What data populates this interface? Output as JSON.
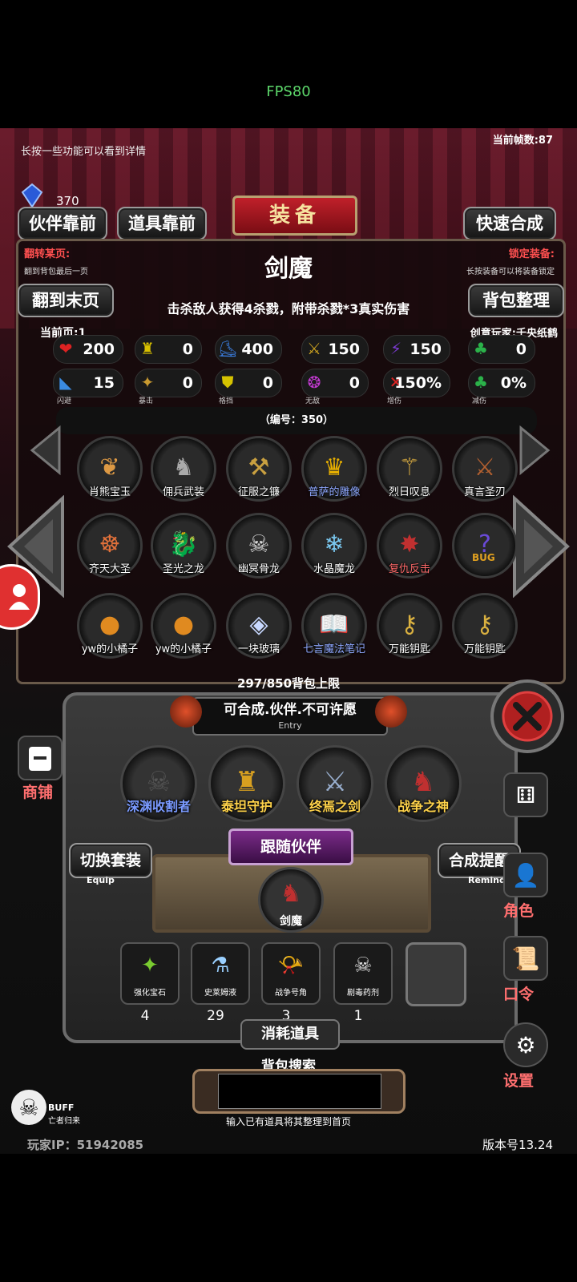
{
  "fps": "FPS80",
  "top_hint": "长按一些功能可以看到详情",
  "framerate": "当前帧数:87",
  "gems": {
    "count": "370"
  },
  "buttons": {
    "partner_first": "伙伴靠前",
    "item_first": "道具靠前",
    "quick_combine": "快速合成",
    "to_last_page": "翻到末页",
    "bag_sort": "背包整理"
  },
  "title": "装备",
  "page_jump": {
    "label": "翻转某页:",
    "desc": "翻到背包最后一页"
  },
  "lock_equip": {
    "label": "锁定装备:",
    "desc": "长按装备可以将装备锁定"
  },
  "item": {
    "name": "剑魔",
    "effect": "击杀敌人获得4杀戮，附带杀戮*3真实伤害",
    "current_page": "当前页:1",
    "creator": "创意玩家:千央纸鹤",
    "serial": "（编号：350）"
  },
  "stats_row1": [
    {
      "icon": "heart-icon",
      "glyph": "❤",
      "color": "#d22",
      "value": "200"
    },
    {
      "icon": "armor-icon",
      "glyph": "♜",
      "color": "#d8c000",
      "value": "0"
    },
    {
      "icon": "boot-icon",
      "glyph": "⛸",
      "color": "#3a7ad8",
      "value": "400"
    },
    {
      "icon": "weapon-icon",
      "glyph": "⚔",
      "color": "#c9a020",
      "value": "150"
    },
    {
      "icon": "lightning-icon",
      "glyph": "⚡",
      "color": "#7a3ad0",
      "value": "150"
    },
    {
      "icon": "clover-icon",
      "glyph": "♣",
      "color": "#2bb24a",
      "value": "0"
    }
  ],
  "stats_row2": [
    {
      "icon": "dodge-icon",
      "glyph": "◣",
      "color": "#3a8ae0",
      "value": "15",
      "label": "闪避"
    },
    {
      "icon": "crit-icon",
      "glyph": "✦",
      "color": "#c99a30",
      "value": "0",
      "label": "暴击"
    },
    {
      "icon": "block-icon",
      "glyph": "⛊",
      "color": "#d6c300",
      "value": "0",
      "label": "格挡"
    },
    {
      "icon": "invincible-icon",
      "glyph": "❂",
      "color": "#c23ad0",
      "value": "0",
      "label": "无敌"
    },
    {
      "icon": "damage-up-icon",
      "glyph": "✕",
      "color": "#d22",
      "value": "150%",
      "label": "增伤"
    },
    {
      "icon": "damage-reduce-icon",
      "glyph": "♣",
      "color": "#2bb24a",
      "value": "0%",
      "label": "减伤"
    }
  ],
  "grid": [
    {
      "name": "肖熊宝玉",
      "icon": "jade-icon",
      "glyph": "❦",
      "color": "#d94",
      "name_color": "#fff"
    },
    {
      "name": "佣兵武装",
      "icon": "knight-icon",
      "glyph": "♞",
      "color": "#aaa",
      "name_color": "#fff"
    },
    {
      "name": "征服之镰",
      "icon": "scythe-icon",
      "glyph": "⚒",
      "color": "#c9a040",
      "name_color": "#fff"
    },
    {
      "name": "普萨的雕像",
      "icon": "statue-icon",
      "glyph": "♛",
      "color": "#e8b000",
      "name_color": "#8fa8ff"
    },
    {
      "name": "烈日叹息",
      "icon": "staff-icon",
      "glyph": "⚚",
      "color": "#e0b040",
      "name_color": "#fff"
    },
    {
      "name": "真言圣刃",
      "icon": "blade-icon",
      "glyph": "⚔",
      "color": "#b26030",
      "name_color": "#fff"
    },
    {
      "name": "齐天大圣",
      "icon": "monkey-king-icon",
      "glyph": "☸",
      "color": "#e0703a",
      "name_color": "#fff"
    },
    {
      "name": "圣光之龙",
      "icon": "gold-dragon-icon",
      "glyph": "🐉",
      "color": "#d0a020",
      "name_color": "#fff"
    },
    {
      "name": "幽冥骨龙",
      "icon": "bone-dragon-icon",
      "glyph": "☠",
      "color": "#ddd",
      "name_color": "#fff"
    },
    {
      "name": "水晶魔龙",
      "icon": "crystal-dragon-icon",
      "glyph": "❄",
      "color": "#7ac8f0",
      "name_color": "#fff"
    },
    {
      "name": "复仇反击",
      "icon": "revenge-icon",
      "glyph": "✸",
      "color": "#c03030",
      "name_color": "#ff6a6a"
    },
    {
      "name": "",
      "icon": "bug-icon",
      "glyph": "?",
      "color": "#6a4ad8",
      "name_color": "#fff",
      "badge": "BUG"
    },
    {
      "name": "yw的小橘子",
      "icon": "orange-icon",
      "glyph": "●",
      "color": "#e08a20",
      "name_color": "#fff"
    },
    {
      "name": "yw的小橘子",
      "icon": "orange-icon",
      "glyph": "●",
      "color": "#e08a20",
      "name_color": "#fff"
    },
    {
      "name": "一块玻璃",
      "icon": "glass-icon",
      "glyph": "◈",
      "color": "#c8d8ff",
      "name_color": "#fff"
    },
    {
      "name": "七言魔法笔记",
      "icon": "spellbook-icon",
      "glyph": "📖",
      "color": "#b06a5a",
      "name_color": "#8fa8ff"
    },
    {
      "name": "万能钥匙",
      "icon": "key-icon",
      "glyph": "⚷",
      "color": "#d9b040",
      "name_color": "#fff"
    },
    {
      "name": "万能钥匙",
      "icon": "key-icon",
      "glyph": "⚷",
      "color": "#d9b040",
      "name_color": "#fff"
    }
  ],
  "bag_capacity": "297/850背包上限",
  "filter": {
    "label": "可合成.伙伴.不可许愿",
    "sub": "Entry"
  },
  "partners": [
    {
      "name": "深渊收割者",
      "icon": "reaper-icon",
      "glyph": "☠",
      "color": "#555",
      "name_color": "#7a9aff"
    },
    {
      "name": "泰坦守护",
      "icon": "titan-icon",
      "glyph": "♜",
      "color": "#d8a020",
      "name_color": "#ffd34a"
    },
    {
      "name": "终焉之剑",
      "icon": "sword-icon",
      "glyph": "⚔",
      "color": "#9ab0d0",
      "name_color": "#ffd34a"
    },
    {
      "name": "战争之神",
      "icon": "war-god-icon",
      "glyph": "♞",
      "color": "#c03030",
      "name_color": "#ffd34a"
    }
  ],
  "follow": {
    "label": "跟随伙伴",
    "name": "剑魔"
  },
  "switch_set": {
    "label": "切换套装",
    "sub": "Equip"
  },
  "combine_remind": {
    "label": "合成提醒",
    "sub": "Remind"
  },
  "consumables": [
    {
      "name": "强化宝石",
      "count": "4",
      "icon": "gem-icon",
      "glyph": "✦",
      "color": "#7acc30"
    },
    {
      "name": "史莱姆液",
      "count": "29",
      "icon": "potion-icon",
      "glyph": "⚗",
      "color": "#9ad0ff"
    },
    {
      "name": "战争号角",
      "count": "3",
      "icon": "horn-icon",
      "glyph": "📯",
      "color": "#c0a0e0"
    },
    {
      "name": "剧毒药剂",
      "count": "1",
      "icon": "poison-icon",
      "glyph": "☠",
      "color": "#ddd"
    },
    {
      "name": "",
      "count": "",
      "icon": "",
      "glyph": "",
      "color": "#333"
    }
  ],
  "consumables_label": "消耗道具",
  "search": {
    "label": "背包搜索",
    "hint": "输入已有道具将其整理到首页",
    "value": ""
  },
  "side_left": {
    "shop": "商铺"
  },
  "side_right": {
    "role": "角色",
    "code": "口令",
    "settings": "设置"
  },
  "buff": {
    "label": "BUFF",
    "sub": "亡者归来"
  },
  "footer": {
    "ip": "玩家IP：51942085",
    "version": "版本号13.24"
  }
}
